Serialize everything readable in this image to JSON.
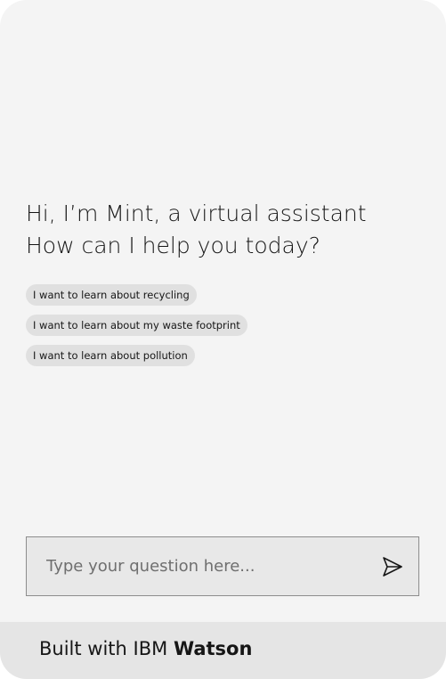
{
  "greeting": {
    "line1": "Hi, I’m Mint, a virtual assistant",
    "line2": "How can I help you today?"
  },
  "suggestions": [
    {
      "label": "I want to learn about recycling"
    },
    {
      "label": "I want to learn about my waste footprint"
    },
    {
      "label": "I want to learn about pollution"
    }
  ],
  "input": {
    "placeholder": "Type your question here...",
    "value": ""
  },
  "send_icon": "send-icon",
  "footer": {
    "prefix": "Built with IBM",
    "brand": "Watson"
  }
}
